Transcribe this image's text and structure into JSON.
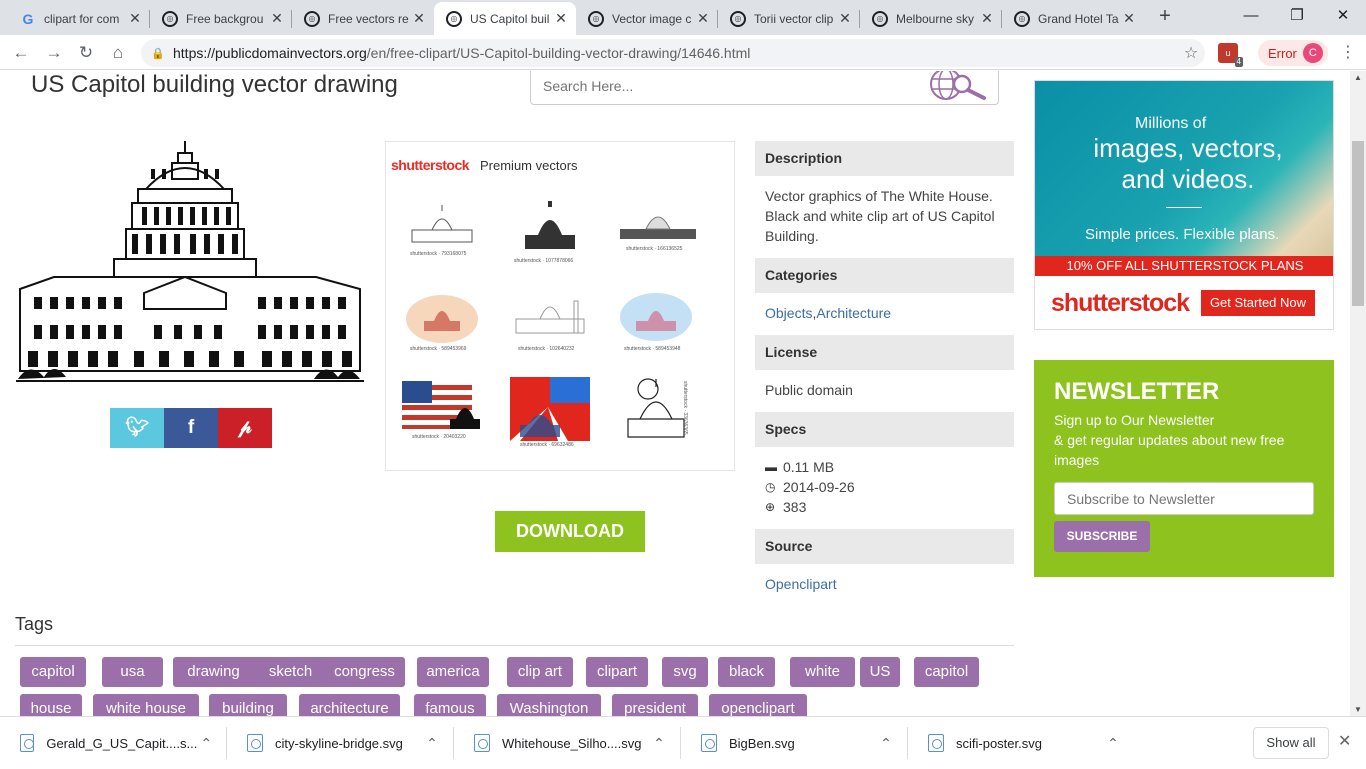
{
  "browser": {
    "tabs": [
      {
        "label": "clipart for com",
        "favicon": "google-icon"
      },
      {
        "label": "Free backgrou",
        "favicon": "pdv-icon"
      },
      {
        "label": "Free vectors re",
        "favicon": "pdv-icon"
      },
      {
        "label": "US Capitol buil",
        "favicon": "pdv-icon",
        "active": true
      },
      {
        "label": "Vector image c",
        "favicon": "pdv-icon"
      },
      {
        "label": "Torii vector clip",
        "favicon": "pdv-icon"
      },
      {
        "label": "Melbourne sky",
        "favicon": "pdv-icon"
      },
      {
        "label": "Grand Hotel Ta",
        "favicon": "pdv-icon"
      }
    ],
    "url_host": "https://publicdomainvectors.org",
    "url_path": "/en/free-clipart/US-Capitol-building-vector-drawing/14646.html",
    "extension_badge": "4",
    "error_label": "Error",
    "profile_initial": "C"
  },
  "page": {
    "title": "US Capitol building vector drawing",
    "search_placeholder": "Search Here...",
    "premium": {
      "logo": "shutterstock",
      "label": "Premium vectors",
      "thumbs": [
        "shutterstock · 793168075",
        "shutterstock · 1077878066",
        "shutterstock · 166136525",
        "shutterstock · 589453969",
        "shutterstock · 102640232",
        "shutterstock · 589453948",
        "shutterstock · 20403220",
        "shutterstock · 69632486",
        "shutterstock · 33636365"
      ]
    },
    "download_label": "DOWNLOAD",
    "info": {
      "description_head": "Description",
      "description": "Vector graphics of The White House. Black and white clip art of US Capitol Building.",
      "categories_head": "Categories",
      "categories": [
        "Objects",
        "Architecture"
      ],
      "license_head": "License",
      "license": "Public domain",
      "specs_head": "Specs",
      "size": "0.11 MB",
      "date": "2014-09-26",
      "downloads": "383",
      "source_head": "Source",
      "source": "Openclipart"
    },
    "ad": {
      "line1": "Millions of",
      "line2": "images, vectors, and videos.",
      "line3": "Simple prices. Flexible plans.",
      "banner": "10% OFF ALL SHUTTERSTOCK PLANS",
      "logo": "shutterstock",
      "cta": "Get Started Now"
    },
    "newsletter": {
      "title": "NEWSLETTER",
      "text1": "Sign up to Our Newsletter",
      "text2": "& get regular updates about new free images",
      "placeholder": "Subscribe to Newsletter",
      "button": "SUBSCRIBE"
    },
    "tags_head": "Tags",
    "tags": [
      "capitol",
      "usa",
      "drawing",
      "sketch",
      "congress",
      "america",
      "clip art",
      "clipart",
      "svg",
      "black",
      "white",
      "US",
      "capitol",
      "house",
      "white house",
      "building",
      "architecture",
      "famous",
      "Washington",
      "president",
      "openclipart"
    ]
  },
  "downloads": {
    "items": [
      "Gerald_G_US_Capit....s...",
      "city-skyline-bridge.svg",
      "Whitehouse_Silho....svg",
      "BigBen.svg",
      "scifi-poster.svg"
    ],
    "show_all": "Show all"
  },
  "colors": {
    "green": "#8dc21f",
    "tag_purple": "#9b6fa9",
    "shutterstock_red": "#e1271d",
    "link_blue": "#3a6ea5"
  }
}
